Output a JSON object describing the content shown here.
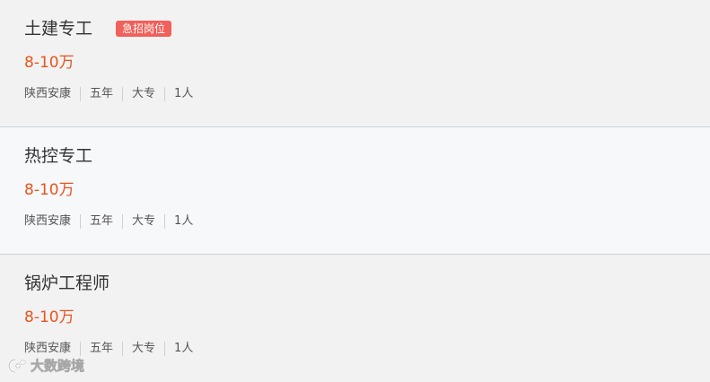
{
  "jobs": [
    {
      "title": "土建专工",
      "badge": "急招岗位",
      "salary": "8-10万",
      "tags": [
        "陕西安康",
        "五年",
        "大专",
        "1人"
      ]
    },
    {
      "title": "热控专工",
      "salary": "8-10万",
      "tags": [
        "陕西安康",
        "五年",
        "大专",
        "1人"
      ]
    },
    {
      "title": "锅炉工程师",
      "salary": "8-10万",
      "tags": [
        "陕西安康",
        "五年",
        "大专",
        "1人"
      ]
    }
  ],
  "watermark": {
    "text": "大数跨境",
    "icon": "brand-logo-icon"
  },
  "colors": {
    "salary": "#e8541e",
    "badge": "#f1605a",
    "card_grey": "#f2f2f2",
    "card_light": "#f7f8fa"
  }
}
